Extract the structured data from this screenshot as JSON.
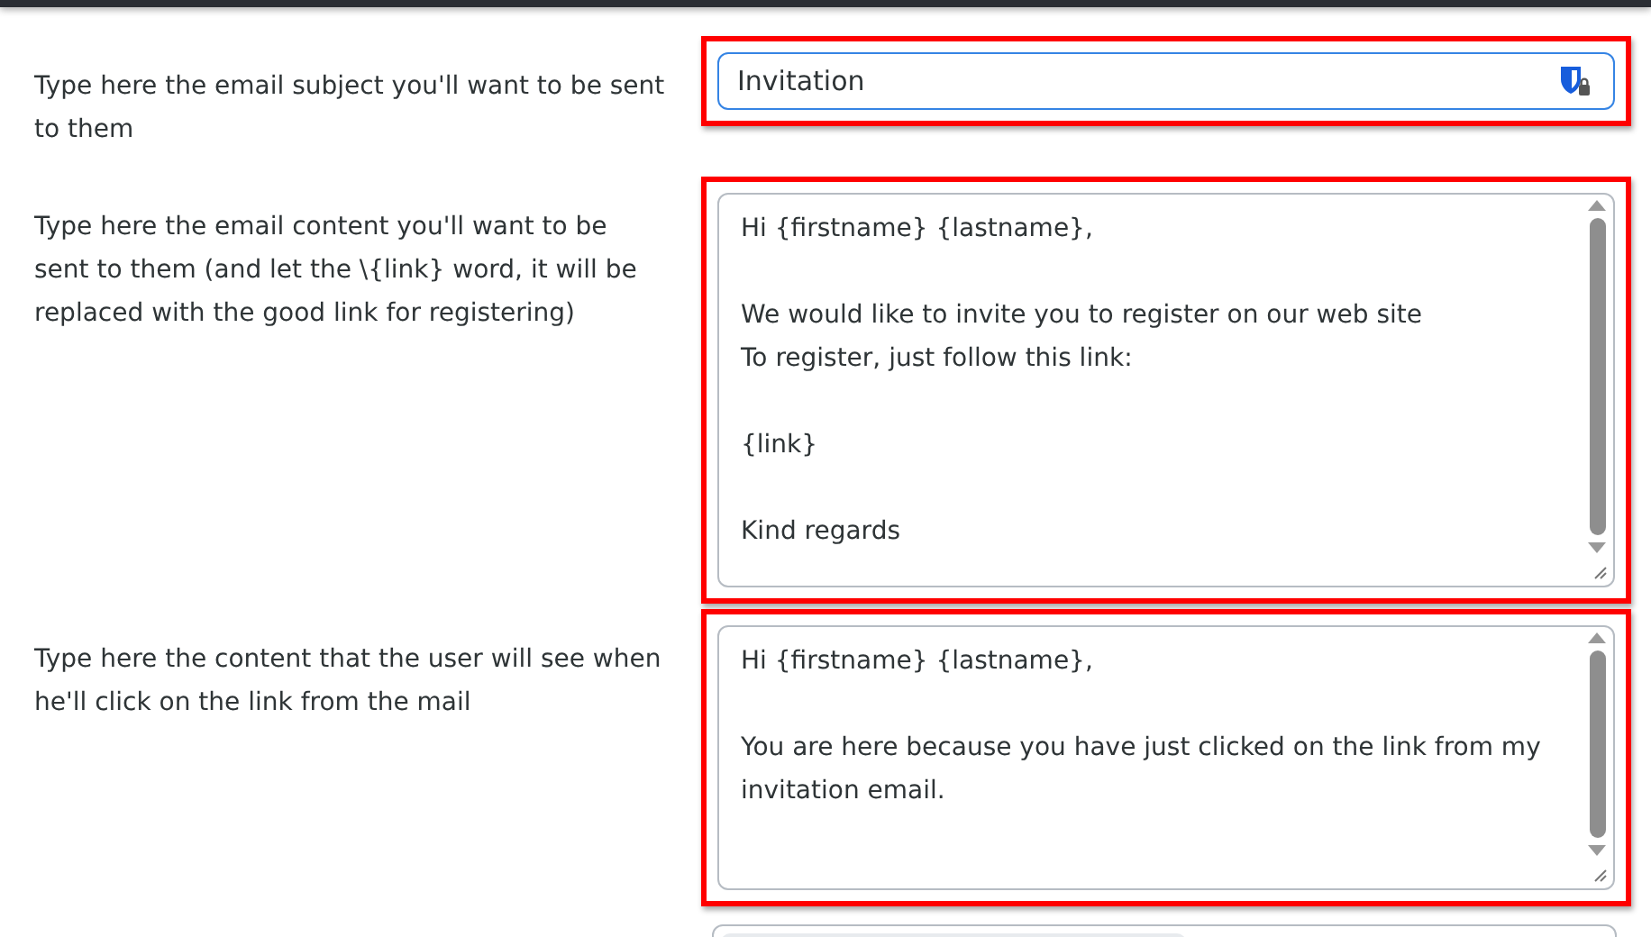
{
  "fields": [
    {
      "kind": "input",
      "label": "Type here the email subject you'll want to be sent to them",
      "value": "Invitation",
      "highlighted": true,
      "focused": true
    },
    {
      "kind": "textarea",
      "label": "Type here the email content you'll want to be sent to them (and let the \\{link} word, it will be replaced with the good link for registering)",
      "value": "Hi {firstname} {lastname},\n\nWe would like to invite you to register on our web site\nTo register, just follow this link:\n\n{link}\n\nKind regards",
      "highlighted": true,
      "focused": false
    },
    {
      "kind": "textarea",
      "label": "Type here the content that the user will see when he'll click on the link from the mail",
      "value": "Hi {firstname} {lastname},\n\nYou are here because you have just clicked on the link from my invitation email.",
      "highlighted": true,
      "focused": false
    }
  ]
}
